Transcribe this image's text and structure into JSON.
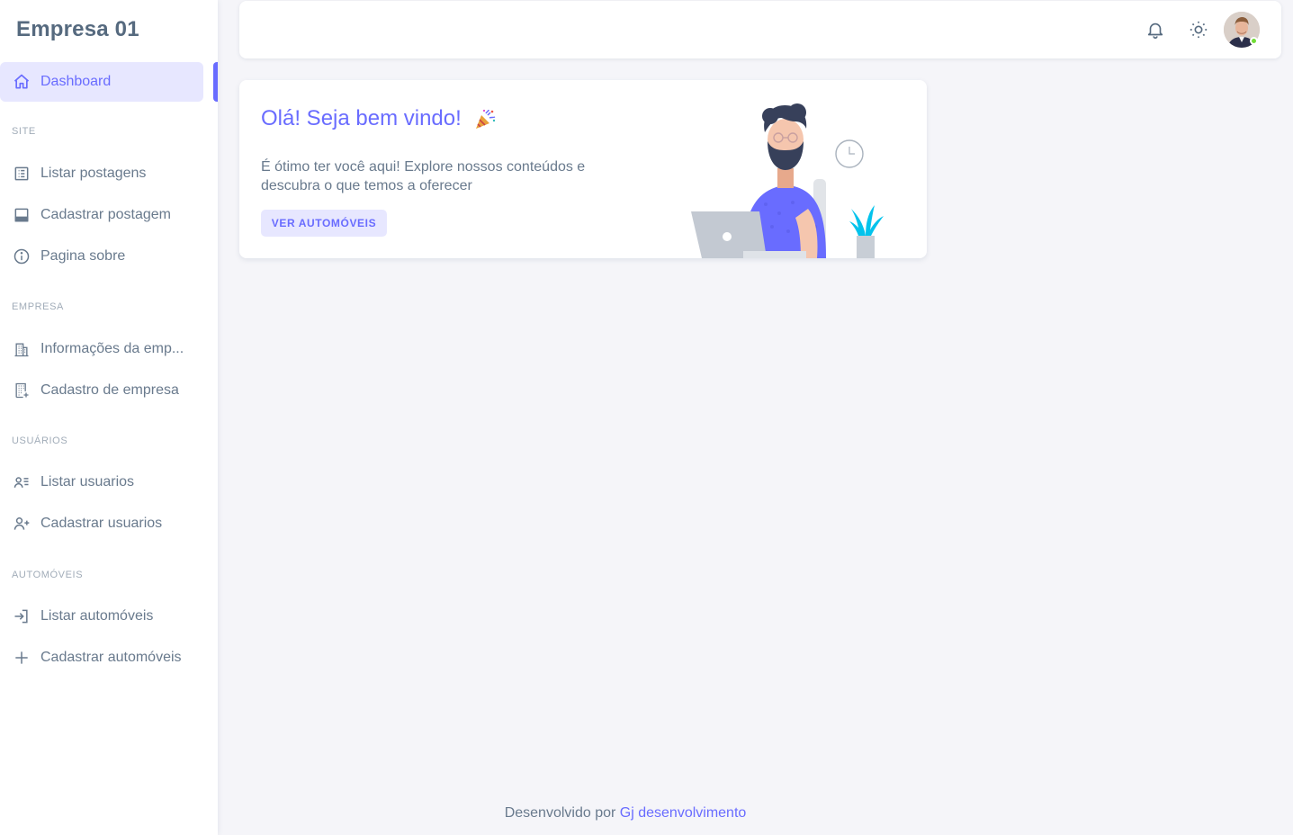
{
  "brand": {
    "name": "Empresa 01"
  },
  "sidebar": {
    "active_item": {
      "label": "Dashboard",
      "icon": "home-icon"
    },
    "sections": [
      {
        "header": "SITE",
        "items": [
          {
            "label": "Listar postagens",
            "icon": "list-icon"
          },
          {
            "label": "Cadastrar postagem",
            "icon": "window-icon"
          },
          {
            "label": "Pagina sobre",
            "icon": "info-circle-icon"
          }
        ]
      },
      {
        "header": "EMPRESA",
        "items": [
          {
            "label": "Informações da emp...",
            "icon": "building-icon"
          },
          {
            "label": "Cadastro de empresa",
            "icon": "building-add-icon"
          }
        ]
      },
      {
        "header": "USUÁRIOS",
        "items": [
          {
            "label": "Listar usuarios",
            "icon": "user-list-icon"
          },
          {
            "label": "Cadastrar usuarios",
            "icon": "user-plus-icon"
          }
        ]
      },
      {
        "header": "AUTOMÓVEIS",
        "items": [
          {
            "label": "Listar automóveis",
            "icon": "log-in-icon"
          },
          {
            "label": "Cadastrar automóveis",
            "icon": "plus-icon"
          }
        ]
      }
    ]
  },
  "navbar": {
    "icons": [
      "bell-icon",
      "sun-icon"
    ],
    "user_status": "online"
  },
  "welcome_card": {
    "title": "Olá! Seja bem vindo!",
    "title_icon": "party-popper-icon",
    "text": "É ótimo ter você aqui! Explore nossos conteúdos e descubra o que temos a oferecer",
    "button_label": "VER AUTOMÓVEIS"
  },
  "footer": {
    "prefix": "Desenvolvido por ",
    "link_text": "Gj desenvolvimento"
  },
  "colors": {
    "primary": "#696cff",
    "primary_light": "#e7e7ff",
    "text": "#697a8d",
    "heading": "#566a7f",
    "background": "#f5f5f9",
    "online": "#71dd37"
  }
}
